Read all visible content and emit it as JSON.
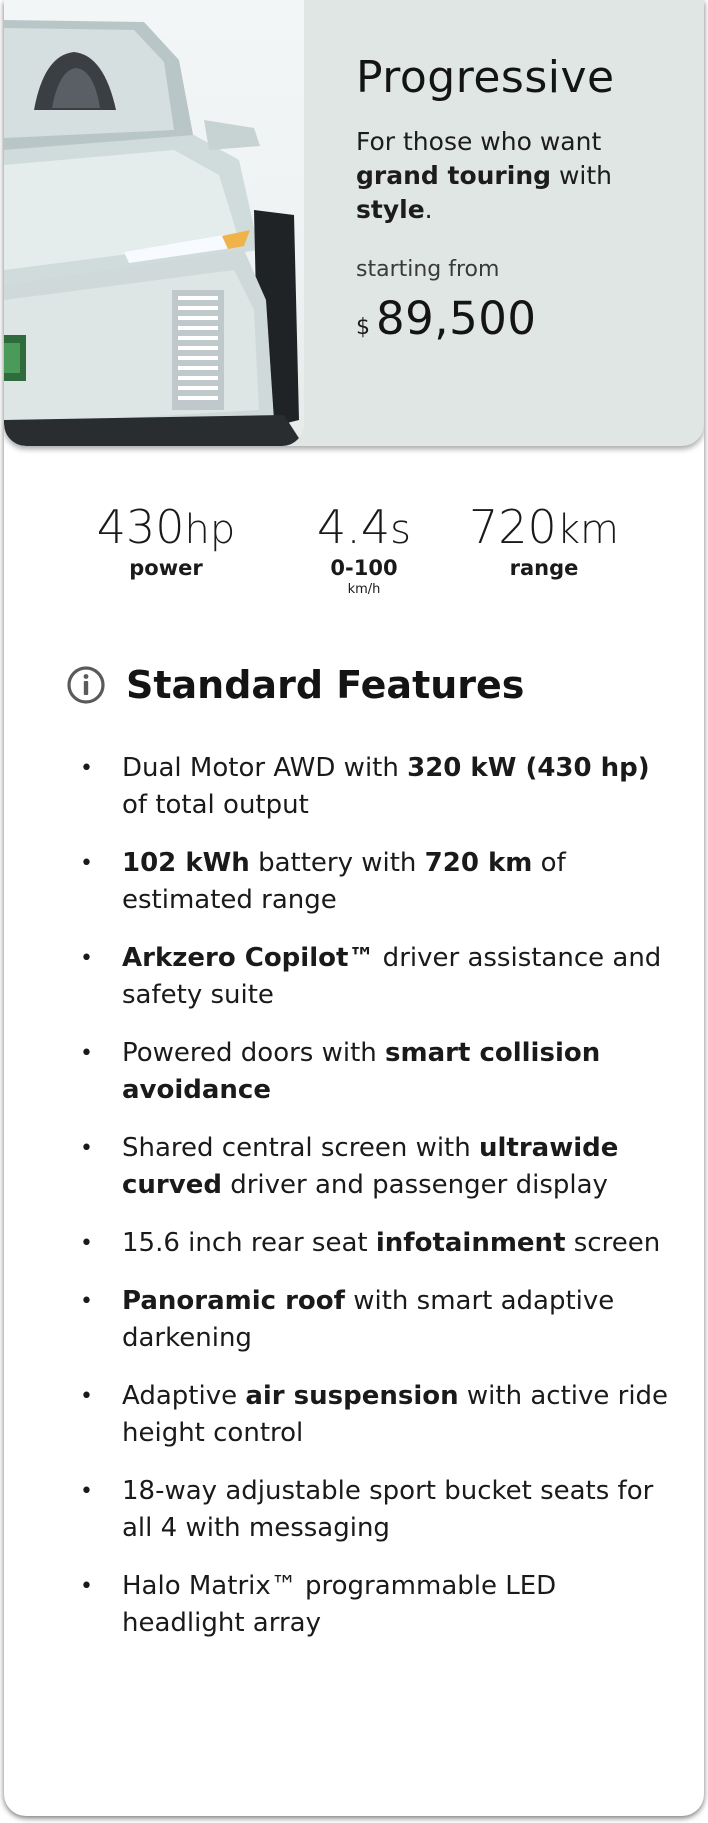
{
  "hero": {
    "title": "Progressive",
    "tagline": {
      "part1": "For those who want ",
      "bold1": "grand touring",
      "part2": " with ",
      "bold2": "style",
      "part3": "."
    },
    "starting_label": "starting from",
    "price_currency": "$",
    "price_value": "89,500",
    "background_color": "#dfe6e3"
  },
  "stats": [
    {
      "value": "430",
      "unit": "hp",
      "label": "power",
      "sublabel": ""
    },
    {
      "value": "4.4",
      "unit": "s",
      "label": "0-100",
      "sublabel": "km/h"
    },
    {
      "value": "720",
      "unit": "km",
      "label": "range",
      "sublabel": ""
    }
  ],
  "features": {
    "icon": "info-icon",
    "title": "Standard Features",
    "bullet": "•",
    "items": [
      {
        "t1": "Dual Motor AWD with ",
        "b1": "320 kW (430 hp)",
        "t2": " of total output",
        "b2": "",
        "t3": ""
      },
      {
        "t1": "",
        "b1": "102 kWh",
        "t2": " battery with ",
        "b2": "720 km",
        "t3": " of estimated range"
      },
      {
        "t1": "",
        "b1": "Arkzero Copilot™",
        "t2": " driver assistance and safety suite",
        "b2": "",
        "t3": ""
      },
      {
        "t1": "Powered doors with ",
        "b1": "smart collision avoidance",
        "t2": "",
        "b2": "",
        "t3": ""
      },
      {
        "t1": "Shared central screen with ",
        "b1": "ultrawide curved",
        "t2": " driver and passenger display",
        "b2": "",
        "t3": ""
      },
      {
        "t1": "15.6 inch rear seat ",
        "b1": "infotainment",
        "t2": " screen",
        "b2": "",
        "t3": ""
      },
      {
        "t1": "",
        "b1": "Panoramic roof",
        "t2": " with smart adaptive darkening",
        "b2": "",
        "t3": ""
      },
      {
        "t1": "Adaptive ",
        "b1": "air suspension",
        "t2": " with active ride height control",
        "b2": "",
        "t3": ""
      },
      {
        "t1": "18-way adjustable sport bucket seats for all 4 with messaging",
        "b1": "",
        "t2": "",
        "b2": "",
        "t3": ""
      },
      {
        "t1": "Halo Matrix™ programmable LED headlight array",
        "b1": "",
        "t2": "",
        "b2": "",
        "t3": ""
      }
    ]
  }
}
